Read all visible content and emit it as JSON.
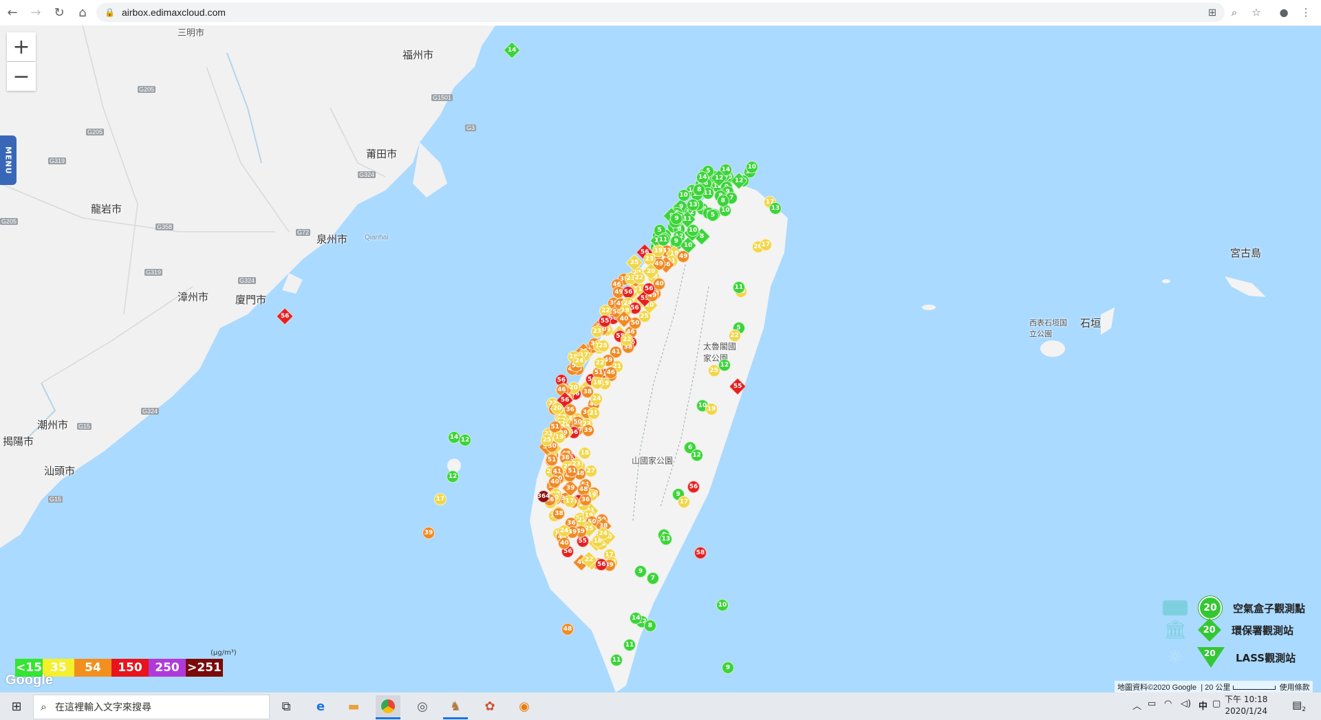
{
  "browser": {
    "url": "airbox.edimaxcloud.com"
  },
  "map": {
    "menu_label": "MENU",
    "zoom_in": "+",
    "zoom_out": "−",
    "places": [
      {
        "id": "fuzhou",
        "name": "福州市"
      },
      {
        "id": "sanming",
        "name": "三明市"
      },
      {
        "id": "putian",
        "name": "莆田市"
      },
      {
        "id": "longyan",
        "name": "龍岩市"
      },
      {
        "id": "quanzhou",
        "name": "泉州市"
      },
      {
        "id": "qianhai",
        "name": "Qianhai"
      },
      {
        "id": "zhangzhou",
        "name": "漳州市"
      },
      {
        "id": "xiamen",
        "name": "廈門市"
      },
      {
        "id": "chaozhou",
        "name": "潮州市"
      },
      {
        "id": "jieyang",
        "name": "揭陽市"
      },
      {
        "id": "shantou",
        "name": "汕頭市"
      },
      {
        "id": "miyako",
        "name": "宮古島"
      },
      {
        "id": "ishigaki",
        "name": "石垣"
      },
      {
        "id": "ishigaki_park",
        "name": "西表石垣国立公園"
      },
      {
        "id": "taroko",
        "name": "太魯閣國家公園"
      },
      {
        "id": "yushan",
        "name": "山國家公園"
      }
    ],
    "highways": [
      "G205",
      "G205",
      "G319",
      "G205",
      "G1501",
      "G3",
      "G324",
      "G72",
      "G319",
      "G324",
      "G15",
      "G324",
      "G15",
      "G358"
    ],
    "markers_sample": [
      {
        "v": "56",
        "c": "red"
      },
      {
        "v": "55",
        "c": "red"
      },
      {
        "v": "56",
        "c": "red"
      },
      {
        "v": "58",
        "c": "red"
      },
      {
        "v": "364",
        "c": "maroon"
      },
      {
        "v": "39",
        "c": "orange"
      },
      {
        "v": "50",
        "c": "orange"
      },
      {
        "v": "49",
        "c": "orange"
      },
      {
        "v": "48",
        "c": "orange"
      },
      {
        "v": "38",
        "c": "orange"
      },
      {
        "v": "41",
        "c": "orange"
      },
      {
        "v": "40",
        "c": "orange"
      },
      {
        "v": "36",
        "c": "orange"
      },
      {
        "v": "46",
        "c": "orange"
      },
      {
        "v": "51",
        "c": "orange"
      },
      {
        "v": "17",
        "c": "yellow"
      },
      {
        "v": "18",
        "c": "yellow"
      },
      {
        "v": "24",
        "c": "yellow"
      },
      {
        "v": "21",
        "c": "yellow"
      },
      {
        "v": "27",
        "c": "yellow"
      },
      {
        "v": "23",
        "c": "yellow"
      },
      {
        "v": "25",
        "c": "yellow"
      },
      {
        "v": "19",
        "c": "yellow"
      },
      {
        "v": "22",
        "c": "yellow"
      },
      {
        "v": "20",
        "c": "yellow"
      },
      {
        "v": "14",
        "c": "green"
      },
      {
        "v": "12",
        "c": "green"
      },
      {
        "v": "13",
        "c": "green"
      },
      {
        "v": "9",
        "c": "green"
      },
      {
        "v": "10",
        "c": "green"
      },
      {
        "v": "8",
        "c": "green"
      },
      {
        "v": "11",
        "c": "green"
      },
      {
        "v": "6",
        "c": "green"
      },
      {
        "v": "5",
        "c": "green"
      },
      {
        "v": "7",
        "c": "green"
      }
    ],
    "attribution": "地圖資料©2020 Google",
    "scale": "20 公里",
    "terms": "使用條款",
    "google_logo": "Google"
  },
  "aqi_legend": {
    "unit": "(μg/m³)",
    "segments": [
      {
        "label": "<15",
        "color": "#34e531"
      },
      {
        "label": "35",
        "color": "#f4f02e"
      },
      {
        "label": "54",
        "color": "#f28f1e"
      },
      {
        "label": "150",
        "color": "#e8131c"
      },
      {
        "label": "250",
        "color": "#b03ad9"
      },
      {
        "label": ">251",
        "color": "#7b0a0a"
      }
    ]
  },
  "station_legend": [
    {
      "label": "空氣盒子觀測點",
      "badge": "20"
    },
    {
      "label": "環保署觀測站",
      "badge": "20"
    },
    {
      "label": "LASS觀測站",
      "badge": "20"
    }
  ],
  "taskbar": {
    "search_placeholder": "在這裡輸入文字來搜尋",
    "ime": "中",
    "time": "下午 10:18",
    "date": "2020/1/24",
    "notifications": "2"
  },
  "colors": {
    "green": "#3cd43a",
    "yellow": "#f2d64a",
    "orange": "#f08a24",
    "red": "#e52020",
    "maroon": "#8b1010"
  }
}
